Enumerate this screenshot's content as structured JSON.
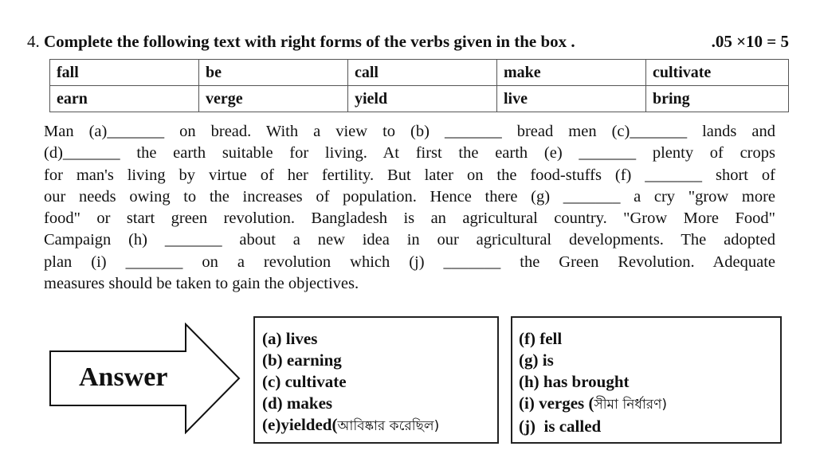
{
  "question": {
    "number": "4.",
    "instruction": "Complete the following text with right forms of the verbs given in the box .",
    "marks": ".05 ×10 = 5"
  },
  "verb_box": {
    "rows": [
      [
        "fall",
        "be",
        "call",
        "make",
        "cultivate"
      ],
      [
        "earn",
        "verge",
        "yield",
        "live",
        "bring"
      ]
    ]
  },
  "passage": {
    "lines": [
      "Man (a)_______ on bread. With a view to (b) _______ bread men (c)_______ lands and",
      "(d)_______ the earth suitable for living. At first the earth (e) _______       plenty of crops",
      "for man's living by virtue of her fertility. But later on the food-stuffs (f) _______ short of",
      "our needs owing to the increases of population. Hence there (g) _______ a cry \"grow more",
      "food\" or start green revolution. Bangladesh is an agricultural country. \"Grow More Food\"",
      "Campaign (h) _______ about a new idea in our agricultural developments. The adopted",
      "plan (i) _______ on a revolution which (j) _______ the Green Revolution. Adequate",
      "measures should be taken to gain the objectives."
    ]
  },
  "answer_label": "Answer",
  "answers": {
    "left": [
      {
        "key": "(a)",
        "value": " lives",
        "note": ""
      },
      {
        "key": "(b)",
        "value": " earning",
        "note": ""
      },
      {
        "key": "(c)",
        "value": " cultivate",
        "note": ""
      },
      {
        "key": "(d)",
        "value": " makes",
        "note": ""
      },
      {
        "key": "(e)",
        "value": "yielded(",
        "note": "আবিষ্কার  করেছিল)"
      }
    ],
    "right": [
      {
        "key": "(f)",
        "value": " fell",
        "note": ""
      },
      {
        "key": "(g)",
        "value": " is",
        "note": ""
      },
      {
        "key": "(h)",
        "value": " has brought",
        "note": ""
      },
      {
        "key": "(i)",
        "value": " verges (",
        "note": "সীমা  নির্ধারণ)"
      },
      {
        "key": "(j)",
        "value": "  is called",
        "note": ""
      }
    ]
  }
}
